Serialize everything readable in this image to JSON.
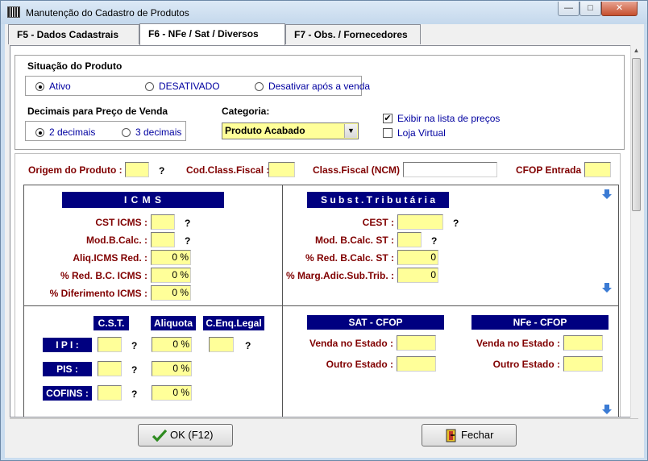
{
  "window": {
    "title": "Manutenção do Cadastro de Produtos",
    "min": "—",
    "max": "□",
    "close": "✕"
  },
  "tabs": [
    {
      "label": "F5 - Dados Cadastrais",
      "active": false
    },
    {
      "label": "F6 - NFe / Sat / Diversos",
      "active": true
    },
    {
      "label": "F7 - Obs. / Fornecedores",
      "active": false
    }
  ],
  "situacao": {
    "title": "Situação do Produto",
    "options": [
      "Ativo",
      "DESATIVADO",
      "Desativar após a venda"
    ],
    "selected": "Ativo"
  },
  "decimais": {
    "title": "Decimais para Preço de Venda",
    "options": [
      "2 decimais",
      "3 decimais"
    ],
    "selected": "2 decimais"
  },
  "categoria": {
    "label": "Categoria:",
    "value": "Produto Acabado"
  },
  "checks": [
    {
      "label": "Exibir na lista de preços",
      "checked": true
    },
    {
      "label": "Loja Virtual",
      "checked": false
    }
  ],
  "fiscal_row": {
    "origem": {
      "label": "Origem do Produto :",
      "value": ""
    },
    "cod_class": {
      "label": "Cod.Class.Fiscal :",
      "value": ""
    },
    "ncm": {
      "label": "Class.Fiscal (NCM) :",
      "value": ""
    },
    "cfop_entrada": {
      "label": "CFOP Entrada :",
      "value": ""
    },
    "q": "?"
  },
  "icms": {
    "header": "I C M S",
    "cst": {
      "label": "CST ICMS :",
      "value": ""
    },
    "mod": {
      "label": "Mod.B.Calc. :",
      "value": ""
    },
    "aliq": {
      "label": "Aliq.ICMS Red. :",
      "value": "0 %"
    },
    "red_bc": {
      "label": "% Red. B.C. ICMS :",
      "value": "0 %"
    },
    "diferimento": {
      "label": "% Diferimento ICMS :",
      "value": "0 %"
    }
  },
  "st": {
    "header": "S u b s t .  T r i b u t á r i a",
    "cest": {
      "label": "CEST :",
      "value": ""
    },
    "mod": {
      "label": "Mod. B.Calc. ST :",
      "value": ""
    },
    "red": {
      "label": "% Red. B.Calc. ST :",
      "value": "0"
    },
    "marg": {
      "label": "% Marg.Adic.Sub.Trib. :",
      "value": "0"
    }
  },
  "impostos": {
    "headers": [
      "C.S.T.",
      "Aliquota",
      "C.Enq.Legal"
    ],
    "rows": [
      {
        "label": "I P I :",
        "cst": "",
        "aliq": "0 %",
        "enq": ""
      },
      {
        "label": "PIS :",
        "cst": "",
        "aliq": "0 %"
      },
      {
        "label": "COFINS :",
        "cst": "",
        "aliq": "0 %"
      }
    ]
  },
  "sat_cfop": {
    "header": "SAT - CFOP",
    "venda": "Venda no Estado :",
    "outro": "Outro Estado :"
  },
  "nfe_cfop": {
    "header": "NFe - CFOP",
    "venda": "Venda no Estado :",
    "outro": "Outro Estado :"
  },
  "buttons": {
    "ok": "OK  (F12)",
    "fechar": "Fechar"
  },
  "colors": {
    "field": "#ffff99",
    "header_bg": "#000080",
    "label_red": "#800000"
  }
}
